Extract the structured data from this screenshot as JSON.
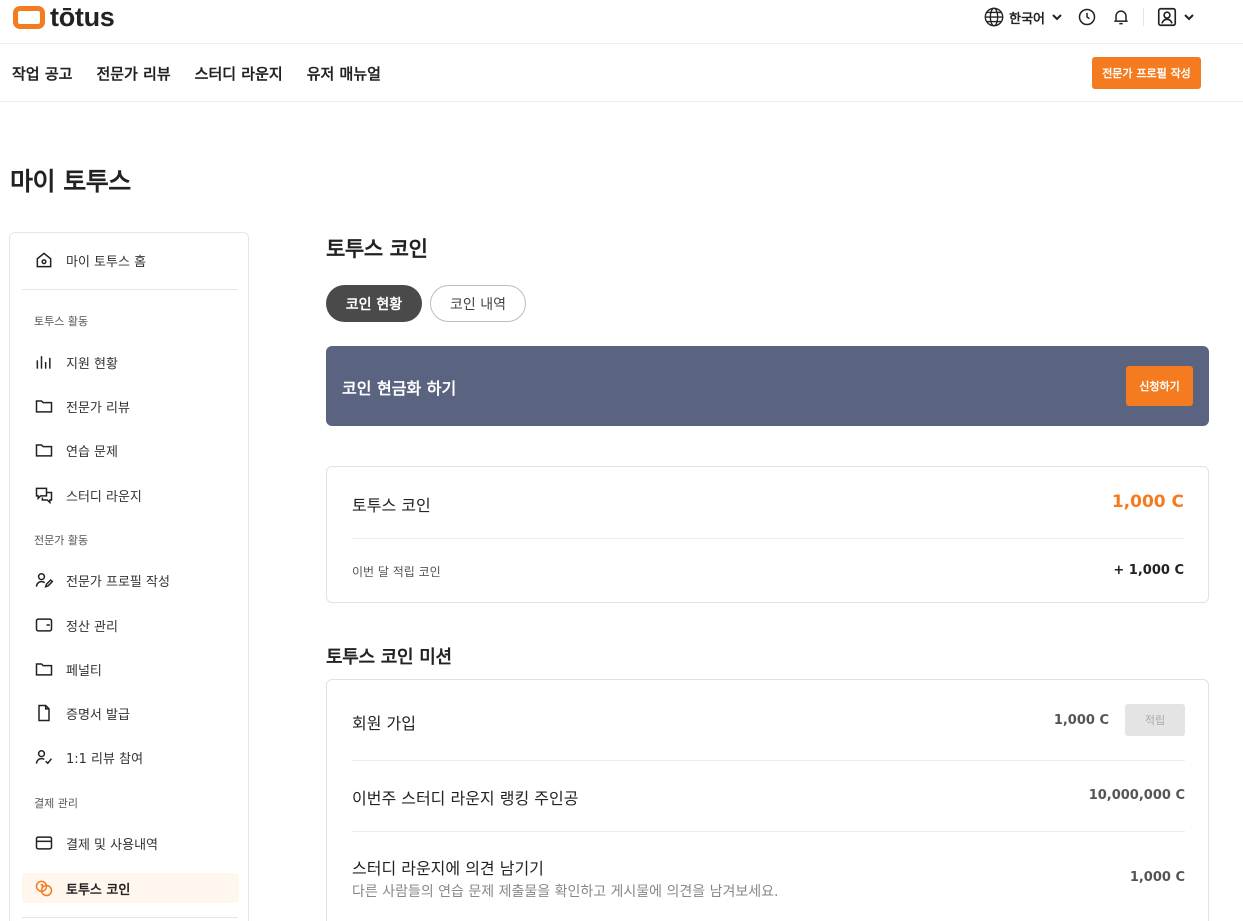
{
  "brand": {
    "name": "tōtus",
    "accent": "#f47b20"
  },
  "header": {
    "language_label": "한국어",
    "icons": [
      "globe-icon",
      "clock-icon",
      "bell-icon",
      "user-icon"
    ]
  },
  "nav": {
    "items": [
      "작업 공고",
      "전문가 리뷰",
      "스터디 라운지",
      "유저 매뉴얼"
    ],
    "cta_label": "전문가 프로필 작성"
  },
  "page_title": "마이 토투스",
  "sidebar": {
    "home": {
      "label": "마이 토투스 홈",
      "icon": "home-icon"
    },
    "sections": [
      {
        "title": "토투스 활동",
        "items": [
          {
            "label": "지원 현황",
            "icon": "bar-chart-icon"
          },
          {
            "label": "전문가 리뷰",
            "icon": "folder-icon"
          },
          {
            "label": "연습 문제",
            "icon": "folder-icon"
          },
          {
            "label": "스터디 라운지",
            "icon": "chat-bubbles-icon"
          }
        ]
      },
      {
        "title": "전문가 활동",
        "items": [
          {
            "label": "전문가 프로필 작성",
            "icon": "user-edit-icon"
          },
          {
            "label": "정산 관리",
            "icon": "wallet-icon"
          },
          {
            "label": "페널티",
            "icon": "folder-icon"
          },
          {
            "label": "증명서 발급",
            "icon": "document-icon"
          },
          {
            "label": "1:1 리뷰 참여",
            "icon": "user-check-icon"
          }
        ]
      },
      {
        "title": "결제 관리",
        "items": [
          {
            "label": "결제 및 사용내역",
            "icon": "credit-card-icon"
          },
          {
            "label": "토투스 코인",
            "icon": "coins-icon",
            "active": true
          }
        ]
      }
    ]
  },
  "main": {
    "title": "토투스 코인",
    "tabs": [
      {
        "label": "코인 현황",
        "active": true
      },
      {
        "label": "코인 내역",
        "active": false
      }
    ],
    "banner": {
      "title": "코인 현금화 하기",
      "button_label": "신청하기",
      "bg_color": "#5a6480"
    },
    "coin_card": {
      "label": "토투스 코인",
      "amount": "1,000 C",
      "sub_label": "이번 달 적립 코인",
      "sub_amount": "+ 1,000 C"
    },
    "mission_title": "토투스 코인 미션",
    "missions": [
      {
        "label": "회원 가입",
        "amount": "1,000 C",
        "button_label": "적립"
      },
      {
        "label": "이번주 스터디 라운지 랭킹 주인공",
        "amount": "10,000,000 C"
      },
      {
        "label": "스터디 라운지에 의견 남기기",
        "description": "다른 사람들의 연습 문제 제출물을 확인하고 게시물에 의견을 남겨보세요.",
        "amount": "1,000 C"
      }
    ]
  }
}
